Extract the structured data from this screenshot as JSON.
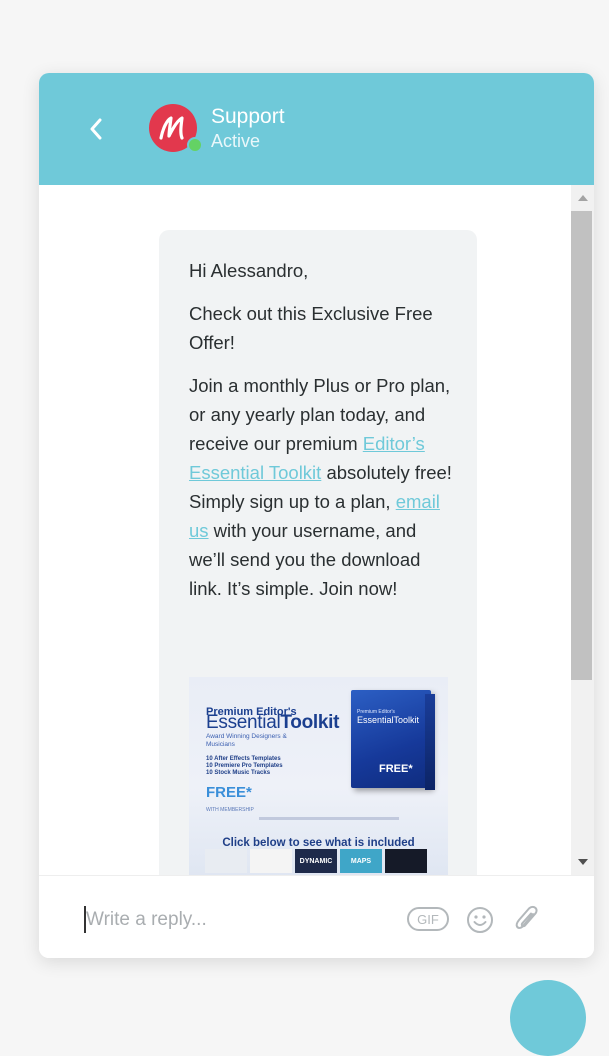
{
  "header": {
    "agent_name": "Support",
    "agent_status": "Active",
    "avatar_letter": "M",
    "accent_color": "#6fc9d9",
    "avatar_color": "#e2384d",
    "online_color": "#64d264"
  },
  "message": {
    "greeting": "Hi Alessandro,",
    "offer": "Check out this Exclusive Free Offer!",
    "body_part1": "Join a monthly Plus or Pro plan, or any yearly plan today, and receive our premium ",
    "link_toolkit": "Editor’s Essential Toolkit",
    "body_part2": " absolutely free! Simply sign up to a plan, ",
    "link_email": "email us",
    "body_part3": " with your username, and we’ll send you the download link. It’s simple. Join now!"
  },
  "promo_image": {
    "line1": "Premium Editor's",
    "line2_a": "Essential",
    "line2_b": "Toolkit",
    "tagline": "Award Winning Designers & Musicians",
    "features": [
      "10 After Effects Templates",
      "10 Premiere Pro Templates",
      "10 Stock Music Tracks"
    ],
    "free_label": "FREE*",
    "free_sub": "WITH MEMBERSHIP",
    "box_line1": "Premium Editor's",
    "box_line2": "EssentialToolkit",
    "box_free": "FREE*",
    "caption": "Click below to see what is included",
    "thumbs": [
      "",
      "",
      "DYNAMIC",
      "MAPS",
      ""
    ]
  },
  "composer": {
    "placeholder": "Write a reply...",
    "gif_label": "GIF"
  },
  "icons": {
    "back": "chevron-left-icon",
    "emoji": "smiley-icon",
    "attach": "paperclip-icon"
  }
}
